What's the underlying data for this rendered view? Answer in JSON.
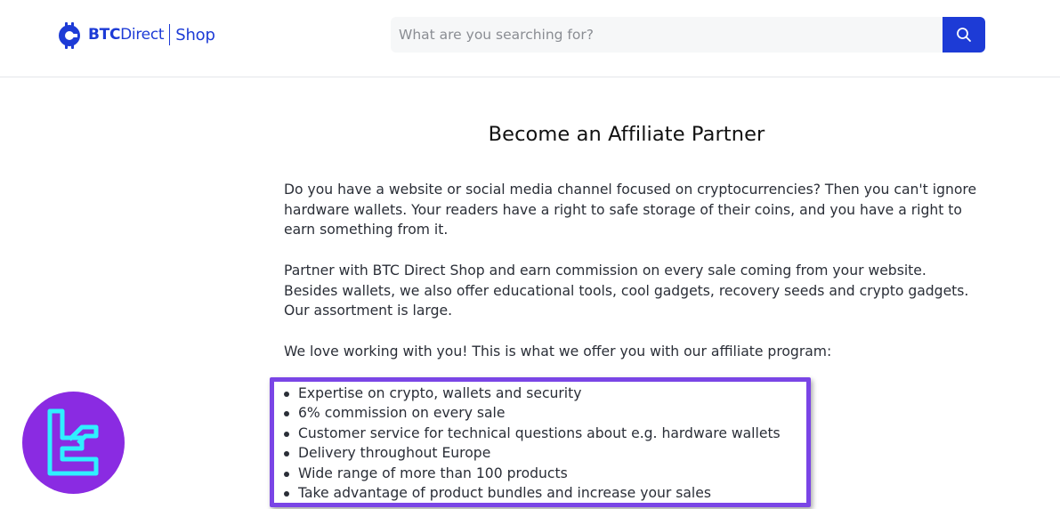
{
  "header": {
    "logo": {
      "brand_bold": "BTC",
      "brand_regular": "Direct",
      "section": "Shop"
    },
    "search": {
      "placeholder": "What are you searching for?",
      "value": ""
    },
    "search_button_icon": "search-icon",
    "colors": {
      "brand": "#1d3bd6"
    }
  },
  "main": {
    "title": "Become an Affiliate Partner",
    "paragraphs": [
      "Do you have a website or social media channel focused on cryptocurrencies? Then you can't ignore hardware wallets. Your readers have a right to safe storage of their coins, and you have a right to earn something from it.",
      "Partner with BTC Direct Shop and earn commission on every sale coming from your website. Besides wallets, we also offer educational tools, cool gadgets, recovery seeds and crypto gadgets. Our assortment is large.",
      "We love working with you! This is what we offer you with our affiliate program:"
    ],
    "benefits": [
      "Expertise on crypto, wallets and security",
      "6% commission on every sale",
      "Customer service for technical questions about e.g. hardware wallets",
      "Delivery throughout Europe",
      "Wide range of more than 100 products",
      "Take advantage of product bundles and increase your sales"
    ],
    "highlight_color": "#7a45e6"
  },
  "overlay": {
    "badge_icon": "tc-logo-icon",
    "badge_color": "#8a2be2"
  }
}
